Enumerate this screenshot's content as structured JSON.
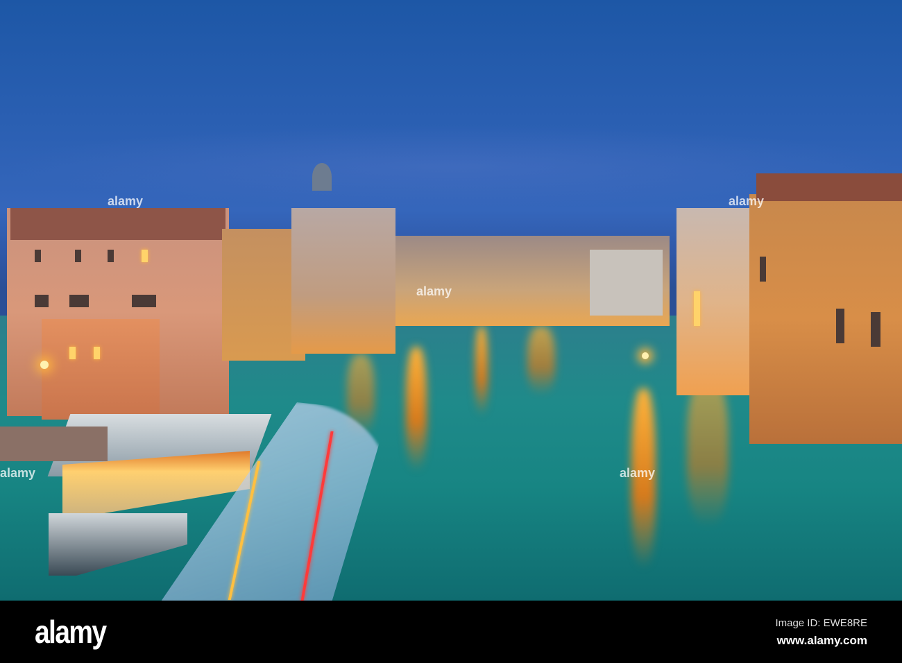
{
  "photo": {
    "subject": "Grand Canal at dusk",
    "colors": {
      "sky": "#2a5fb2",
      "water": "#178583",
      "building_glow": "#e89a4a",
      "light": "#ffd36a"
    }
  },
  "watermark": {
    "text": "alamy"
  },
  "footer": {
    "logo": "alamy",
    "image_id": "Image ID: EWE8RE",
    "website": "www.alamy.com"
  }
}
